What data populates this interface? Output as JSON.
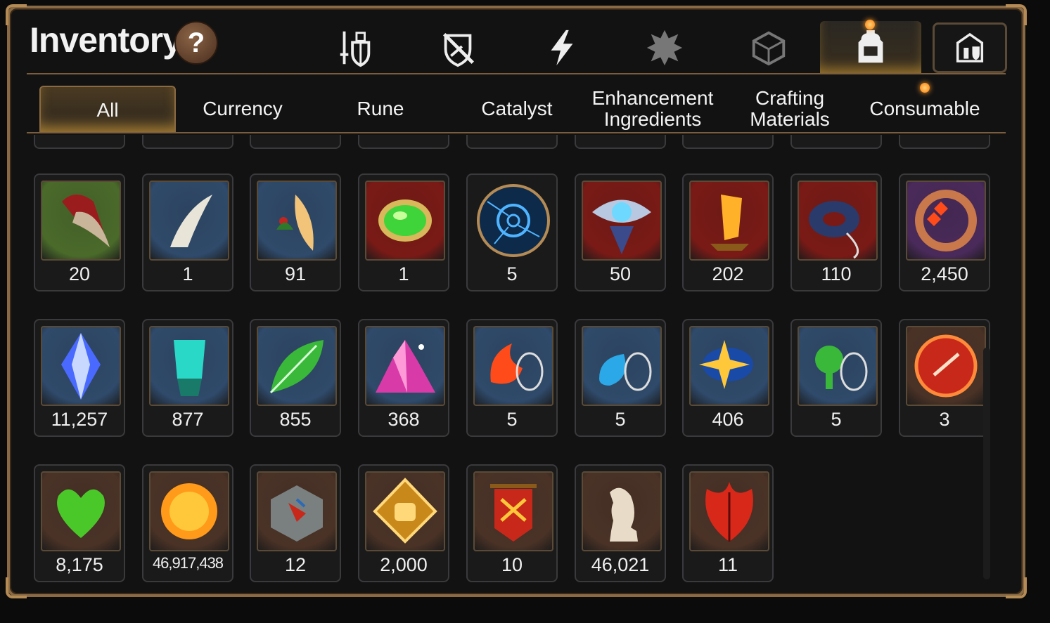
{
  "title": "Inventory",
  "help_label": "?",
  "category_tabs": [
    {
      "icon": "sword-shield-icon",
      "active": false
    },
    {
      "icon": "shield-slash-icon",
      "active": false
    },
    {
      "icon": "lightning-icon",
      "active": false
    },
    {
      "icon": "flame-crest-icon",
      "active": false
    },
    {
      "icon": "box-icon",
      "active": false
    },
    {
      "icon": "backpack-icon",
      "active": true
    },
    {
      "icon": "castle-icon",
      "active": false
    }
  ],
  "sub_tabs": [
    {
      "label": "All",
      "active": true
    },
    {
      "label": "Currency"
    },
    {
      "label": "Rune"
    },
    {
      "label": "Catalyst"
    },
    {
      "label": "Enhancement\nIngredients"
    },
    {
      "label": "Crafting\nMaterials"
    },
    {
      "label": "Consumable"
    }
  ],
  "items": [
    [
      {
        "icon": "red-claw-icon",
        "count": "20",
        "bg": "#4a6a2a"
      },
      {
        "icon": "fang-icon",
        "count": "1",
        "bg": "#2f4a6a"
      },
      {
        "icon": "feather-icon",
        "count": "91",
        "bg": "#2f4a6a"
      },
      {
        "icon": "green-orb-icon",
        "count": "1",
        "bg": "#7a1a16"
      },
      {
        "icon": "blue-rune-icon",
        "count": "5",
        "bg": "round"
      },
      {
        "icon": "eye-crest-icon",
        "count": "50",
        "bg": "#7a1a16"
      },
      {
        "icon": "gold-crystal-icon",
        "count": "202",
        "bg": "#7a1a16"
      },
      {
        "icon": "blue-ring-icon",
        "count": "110",
        "bg": "#7a1a16"
      },
      {
        "icon": "red-flower-ring-icon",
        "count": "2,450",
        "bg": "#4a2a5a"
      }
    ],
    [
      {
        "icon": "blue-crystal-icon",
        "count": "11,257",
        "bg": "#2f4a6a"
      },
      {
        "icon": "teal-gem-icon",
        "count": "877",
        "bg": "#2f4a6a"
      },
      {
        "icon": "green-leaf-icon",
        "count": "855",
        "bg": "#2f4a6a"
      },
      {
        "icon": "pink-crystal-pile-icon",
        "count": "368",
        "bg": "#2f4a6a"
      },
      {
        "icon": "fire-pendant-icon",
        "count": "5",
        "bg": "#2f4a6a"
      },
      {
        "icon": "water-pendant-icon",
        "count": "5",
        "bg": "#2f4a6a"
      },
      {
        "icon": "star-pendant-icon",
        "count": "406",
        "bg": "#2f4a6a"
      },
      {
        "icon": "tree-pendant-icon",
        "count": "5",
        "bg": "#2f4a6a"
      },
      {
        "icon": "red-seal-icon",
        "count": "3",
        "bg": "#4a3226"
      }
    ],
    [
      {
        "icon": "green-heart-icon",
        "count": "8,175",
        "bg": "#4a3226"
      },
      {
        "icon": "gold-coin-icon",
        "count": "46,917,438",
        "bg": "#4a3226",
        "small": true
      },
      {
        "icon": "compass-stone-icon",
        "count": "12",
        "bg": "#4a3226"
      },
      {
        "icon": "fist-emblem-icon",
        "count": "2,000",
        "bg": "#4a3226"
      },
      {
        "icon": "war-banner-icon",
        "count": "10",
        "bg": "#4a3226"
      },
      {
        "icon": "knight-chess-icon",
        "count": "46,021",
        "bg": "#4a3226"
      },
      {
        "icon": "red-leaf-icon",
        "count": "11",
        "bg": "#4a3226"
      }
    ]
  ],
  "colors": {
    "accent_gold": "#f0b43c",
    "frame_bronze": "#8a6a44",
    "notification_orange": "#ff7a00"
  }
}
